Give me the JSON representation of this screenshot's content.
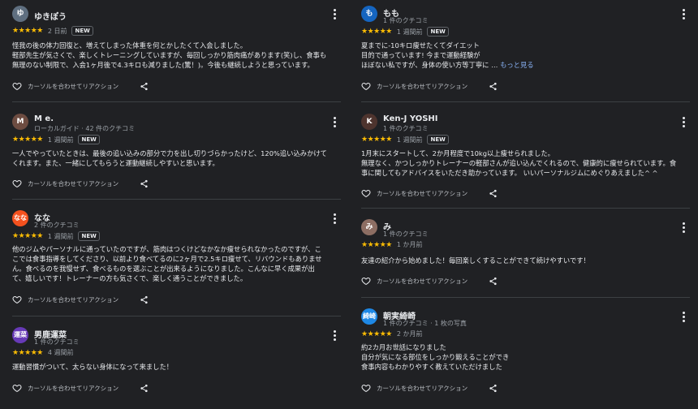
{
  "actions": {
    "react_label": "カーソルを合わせてリアクション"
  },
  "colors": {
    "background": "#202124",
    "star": "#fbbc04",
    "link": "#8ab4f8"
  },
  "left_reviews": [
    {
      "avatar_text": "ゆ",
      "avatar_color": "#5f6f80",
      "name": "ゆきぽう",
      "meta": "",
      "stars": "★★★★★",
      "time": "2 日前",
      "new_label": "NEW",
      "lines": [
        "怪我の後の体力回復と、増えてしまった体重を何とかしたくて入会しました。",
        "軽部先生が気さくで、楽しくトレーニングしていますが、毎回しっかり筋肉痛があります(笑)し、食事も",
        "無理のない制限で、入会1ヶ月後で4.3キロも減りました(驚！)。今後も継続しようと思っています。"
      ]
    },
    {
      "avatar_text": "M",
      "avatar_color": "#6d4c41",
      "name": "M e.",
      "meta": "ローカルガイド · 42 件のクチコミ",
      "stars": "★★★★★",
      "time": "1 週間前",
      "new_label": "NEW",
      "lines": [
        "一人でやっていたときは、最後の追い込みの部分で力を出し切りづらかったけど、120%追い込みかけて",
        "くれます。また、一緒にしてもらうと運動継続しやすいと思います。"
      ]
    },
    {
      "avatar_text": "なな",
      "avatar_color": "#f4511e",
      "name": "なな",
      "meta": "2 件のクチコミ",
      "stars": "★★★★★",
      "time": "1 週間前",
      "new_label": "NEW",
      "lines": [
        "他のジムやパーソナルに通っていたのですが、筋肉はつくけどなかなか痩せられなかったのですが、こ",
        "こでは食事指導をしてくださり、以前より食べてるのに2ヶ月で2.5キロ痩せて、リバウンドもありませ",
        "ん。食べるのを我慢せず、食べるものを選ぶことが出来るようになりました。こんなに早く成果が出",
        "て、嬉しいです！トレーナーの方も気さくで、楽しく通うことができました。"
      ]
    },
    {
      "avatar_text": "運菜",
      "avatar_color": "#673ab7",
      "name": "男鹿運菜",
      "meta": "1 件のクチコミ",
      "stars": "★★★★★",
      "time": "4 週間前",
      "new_label": "",
      "lines": [
        "運動習慣がついて、太らない身体になって来ました！"
      ]
    }
  ],
  "right_reviews": [
    {
      "avatar_text": "も",
      "avatar_color": "#1565c0",
      "name": "もも",
      "meta": "1 件のクチコミ",
      "stars": "★★★★★",
      "time": "1 週間前",
      "new_label": "NEW",
      "lines": [
        "夏までに-10キロ痩せたくてダイエット",
        "目的で通っています! 今まで運動経験が",
        "ほぼない私ですが、身体の使い方等丁寧に …"
      ],
      "more_label": "もっと見る"
    },
    {
      "avatar_text": "K",
      "avatar_color": "#4e342e",
      "name": "Ken-J YOSHI",
      "meta": "1 件のクチコミ",
      "stars": "★★★★★",
      "time": "1 週間前",
      "new_label": "NEW",
      "lines": [
        "1月末にスタートして、2か月程度で10kg以上痩せられました。",
        "無理なく、かつしっかりトレーナーの軽部さんが追い込んでくれるので、健康的に痩せられています。食",
        "事に関してもアドバイスをいただき助かっています。 いいパーソナルジムにめぐりあえました^ ^"
      ]
    },
    {
      "avatar_text": "み",
      "avatar_color": "#8d6e63",
      "name": "み",
      "meta": "1 件のクチコミ",
      "stars": "★★★★★",
      "time": "1 か月前",
      "new_label": "",
      "lines": [
        "友達の紹介から始めました！毎回楽しくすることができて続けやすいです！"
      ]
    },
    {
      "avatar_text": "綺崎",
      "avatar_color": "#1e88e5",
      "name": "朝実綺崎",
      "meta": "1 件のクチコミ · 1 枚の写真",
      "stars": "★★★★★",
      "time": "2 か月前",
      "new_label": "",
      "lines": [
        "約2カ月お世話になりました",
        "自分が気になる部位をしっかり鍛えることができ",
        "食事内容もわかりやすく教えていただけました"
      ]
    }
  ]
}
